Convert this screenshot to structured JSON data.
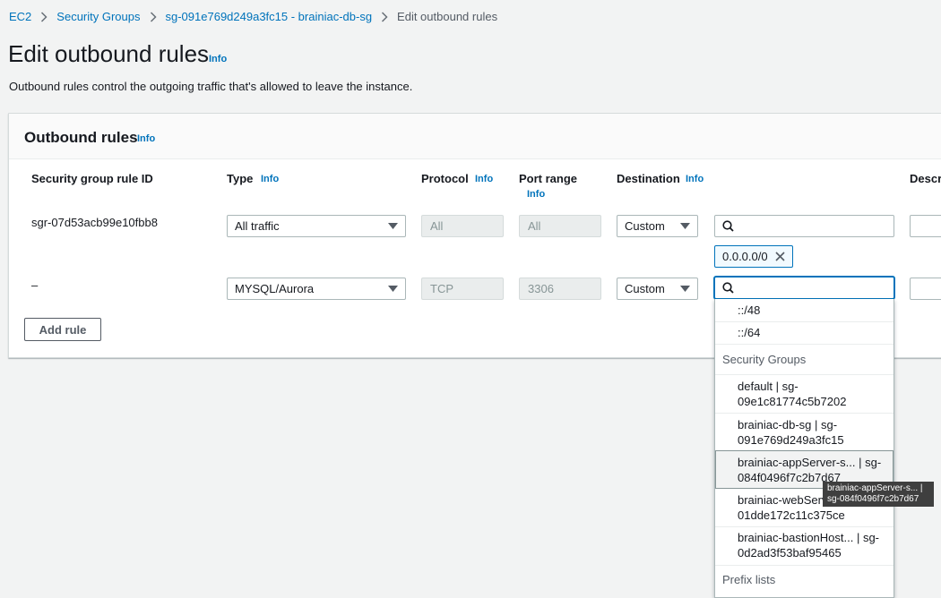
{
  "breadcrumb": {
    "items": [
      "EC2",
      "Security Groups",
      "sg-091e769d249a3fc15 - brainiac-db-sg"
    ],
    "current": "Edit outbound rules"
  },
  "page": {
    "title": "Edit outbound rules",
    "info": "Info",
    "description": "Outbound rules control the outgoing traffic that's allowed to leave the instance."
  },
  "panel": {
    "title": "Outbound rules",
    "info": "Info",
    "columns": {
      "rule_id": "Security group rule ID",
      "type": "Type",
      "type_info": "Info",
      "protocol": "Protocol",
      "protocol_info": "Info",
      "port_range": "Port range",
      "port_range_info": "Info",
      "destination": "Destination",
      "destination_info": "Info",
      "description": "Descri"
    },
    "rows": [
      {
        "rule_id": "sgr-07d53acb99e10fbb8",
        "type": "All traffic",
        "protocol": "All",
        "port_range": "All",
        "destination": "Custom",
        "search_value": "",
        "token": "0.0.0.0/0"
      },
      {
        "rule_id": "–",
        "type": "MYSQL/Aurora",
        "protocol": "TCP",
        "port_range": "3306",
        "destination": "Custom",
        "search_value": ""
      }
    ],
    "add_rule": "Add rule"
  },
  "dropdown": {
    "options_top": [
      "::/48",
      "::/64"
    ],
    "group_security": "Security Groups",
    "security_groups": [
      {
        "line1": "default | sg-",
        "line2": "09e1c81774c5b7202"
      },
      {
        "line1": "brainiac-db-sg | sg-",
        "line2": "091e769d249a3fc15"
      },
      {
        "line1": "brainiac-appServer-s... | sg-",
        "line2": "084f0496f7c2b7d67"
      },
      {
        "line1": "brainiac-webServ",
        "line2": "01dde172c11c375ce"
      },
      {
        "line1": "brainiac-bastionHost... | sg-",
        "line2": "0d2ad3f53baf95465"
      }
    ],
    "group_prefix": "Prefix lists"
  },
  "tooltip": {
    "line1": "brainiac-appServer-s... |",
    "line2": "sg-084f0496f7c2b7d67"
  },
  "colors": {
    "link": "#0073bb",
    "background": "#f2f3f3",
    "border": "#aab7b8"
  }
}
